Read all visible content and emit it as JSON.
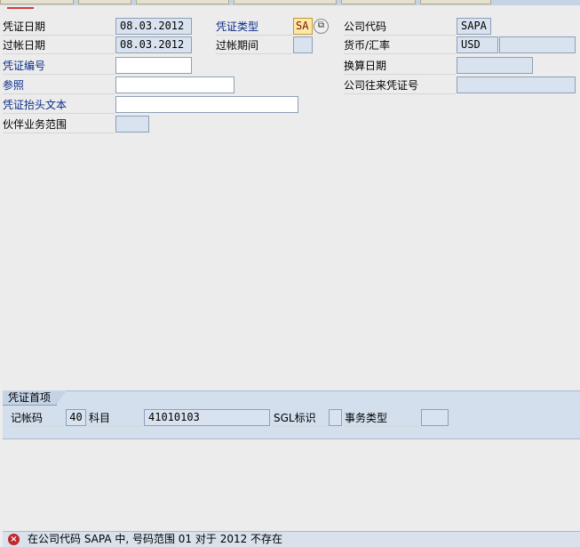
{
  "header": {
    "doc_date": {
      "label": "凭证日期",
      "value": "08.03.2012"
    },
    "doc_type": {
      "label": "凭证类型",
      "value": "SA"
    },
    "company_code": {
      "label": "公司代码",
      "value": "SAPA"
    },
    "posting_date": {
      "label": "过帐日期",
      "value": "08.03.2012"
    },
    "posting_period": {
      "label": "过帐期间",
      "value": ""
    },
    "currency": {
      "label": "货币/汇率",
      "value": "USD",
      "rate": ""
    },
    "doc_number": {
      "label": "凭证编号",
      "value": ""
    },
    "translation_date": {
      "label": "换算日期",
      "value": ""
    },
    "reference": {
      "label": "参照",
      "value": ""
    },
    "intercompany_number": {
      "label": "公司往来凭证号",
      "value": ""
    },
    "header_text": {
      "label": "凭证抬头文本",
      "value": ""
    },
    "trading_partner": {
      "label": "伙伴业务范围",
      "value": ""
    }
  },
  "first_item": {
    "tab_label": "凭证首项",
    "posting_key": {
      "label": "记帐码",
      "value": "40"
    },
    "account": {
      "label": "科目",
      "value": "41010103"
    },
    "sgl_indicator": {
      "label": "SGL标识",
      "value": ""
    },
    "transaction_type": {
      "label": "事务类型",
      "value": ""
    }
  },
  "status": {
    "message": "在公司代码 SAPA 中, 号码范围 01 对于 2012 不存在",
    "type_icon": "error-icon"
  }
}
